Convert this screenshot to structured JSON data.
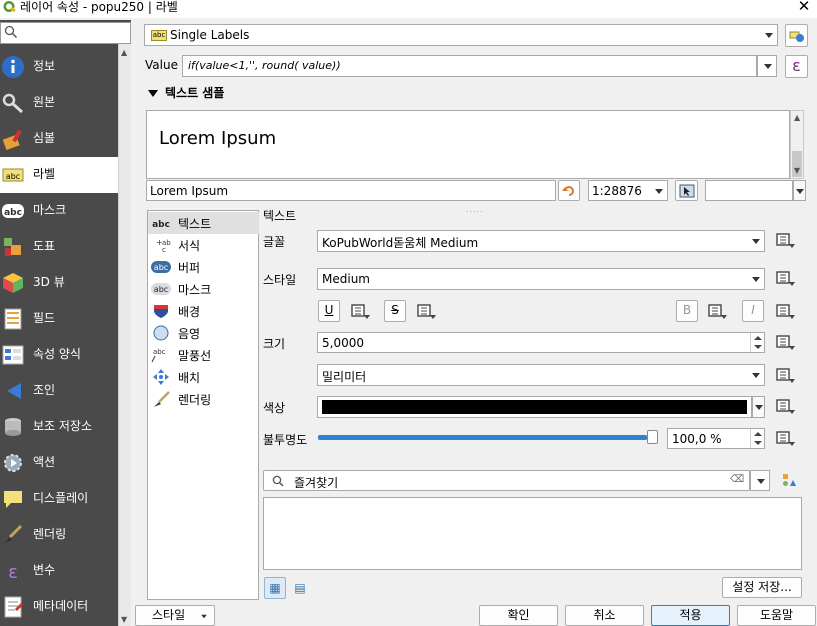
{
  "window": {
    "title": "레이어 속성 - popu250 | 라벨"
  },
  "nav": {
    "search_placeholder": "",
    "items": [
      {
        "label": "정보",
        "icon": "info-icon"
      },
      {
        "label": "원본",
        "icon": "source-wrench-icon"
      },
      {
        "label": "심볼",
        "icon": "symbology-paint-icon"
      },
      {
        "label": "라벨",
        "icon": "labels-abc-icon"
      },
      {
        "label": "마스크",
        "icon": "mask-abc-icon"
      },
      {
        "label": "도표",
        "icon": "diagram-icon"
      },
      {
        "label": "3D 뷰",
        "icon": "3d-cube-icon"
      },
      {
        "label": "필드",
        "icon": "fields-icon"
      },
      {
        "label": "속성 양식",
        "icon": "attribute-form-icon"
      },
      {
        "label": "조인",
        "icon": "join-icon"
      },
      {
        "label": "보조 저장소",
        "icon": "auxiliary-storage-icon"
      },
      {
        "label": "액션",
        "icon": "action-gear-icon"
      },
      {
        "label": "디스플레이",
        "icon": "display-bubble-icon"
      },
      {
        "label": "렌더링",
        "icon": "rendering-brush-icon"
      },
      {
        "label": "변수",
        "icon": "variables-epsilon-icon"
      },
      {
        "label": "메타데이터",
        "icon": "metadata-icon"
      }
    ]
  },
  "labeling": {
    "mode": "Single Labels",
    "value_label": "Value",
    "value_expression": "if(value<1,'', round( value))",
    "sample_section_title": "텍스트 샘플",
    "preview_text": "Lorem Ipsum",
    "sample_input": "Lorem Ipsum",
    "scale": "1:28876"
  },
  "tabs": [
    {
      "label": "텍스트",
      "icon": "text-abc-icon"
    },
    {
      "label": "서식",
      "icon": "formatting-icon"
    },
    {
      "label": "버퍼",
      "icon": "buffer-abc-icon"
    },
    {
      "label": "마스크",
      "icon": "mask-abc-icon"
    },
    {
      "label": "배경",
      "icon": "background-shield-icon"
    },
    {
      "label": "음영",
      "icon": "shadow-icon"
    },
    {
      "label": "말풍선",
      "icon": "callout-icon"
    },
    {
      "label": "배치",
      "icon": "placement-icon"
    },
    {
      "label": "렌더링",
      "icon": "rendering-brush-icon"
    }
  ],
  "text": {
    "section_title": "텍스트",
    "font_label": "글꼴",
    "font_value": "KoPubWorld돋움체 Medium",
    "style_label": "스타일",
    "style_value": "Medium",
    "underline": "U",
    "strike": "S",
    "bold": "B",
    "italic": "I",
    "size_label": "크기",
    "size_value": "5,0000",
    "size_unit": "밀리미터",
    "color_label": "색상",
    "color_value": "#000000",
    "opacity_label": "불투명도",
    "opacity_fraction": 1.0,
    "opacity_value": "100,0 %"
  },
  "favorites": {
    "search_placeholder": "즐겨찾기",
    "save_style_button": "설정 저장..."
  },
  "footer": {
    "style_button": "스타일",
    "ok": "확인",
    "cancel": "취소",
    "apply": "적용",
    "help": "도움말"
  }
}
